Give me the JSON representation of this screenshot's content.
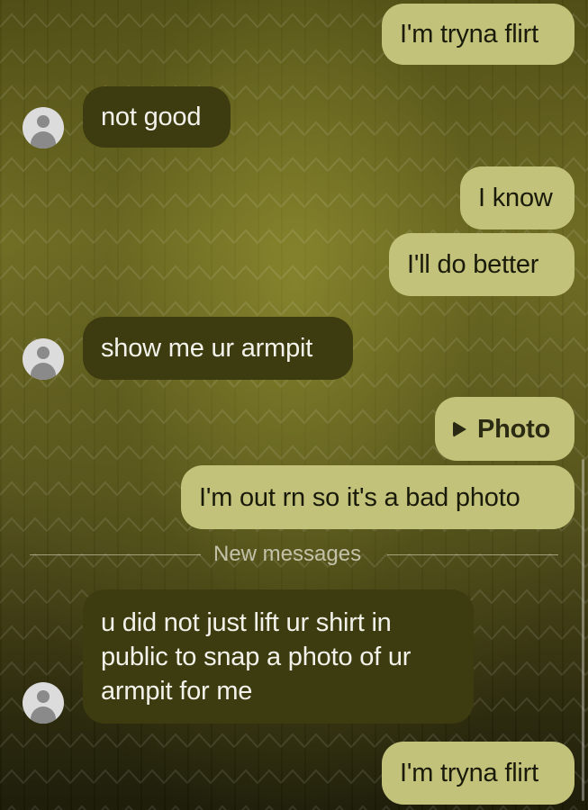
{
  "messages": [
    {
      "direction": "outgoing",
      "text": "I'm tryna flirt"
    },
    {
      "direction": "incoming",
      "text": "not good"
    },
    {
      "direction": "outgoing",
      "text": "I know"
    },
    {
      "direction": "outgoing",
      "text": "I'll do better"
    },
    {
      "direction": "incoming",
      "text": "show me ur armpit"
    },
    {
      "direction": "outgoing",
      "type": "attachment",
      "text": "Photo",
      "icon": "play-icon"
    },
    {
      "direction": "outgoing",
      "text": "I'm out rn so it's a bad photo"
    },
    {
      "direction": "incoming",
      "text": "u did not just lift ur shirt in public to snap a photo of ur armpit for me"
    },
    {
      "direction": "outgoing",
      "text": "I'm tryna flirt"
    }
  ],
  "divider": {
    "label": "New messages"
  },
  "colors": {
    "outgoing_bubble": "#c2c27a",
    "incoming_bubble": "#3d3b10",
    "avatar": "#dcdcdc"
  }
}
